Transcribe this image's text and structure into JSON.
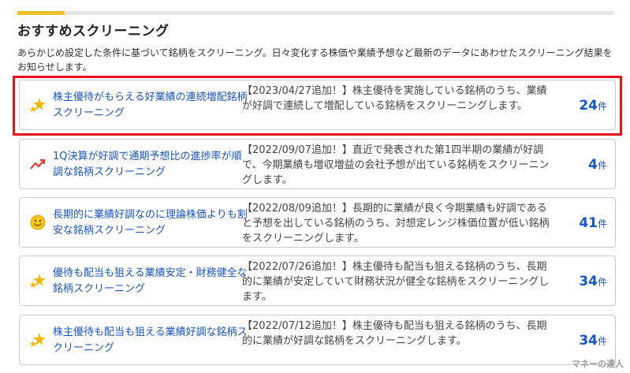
{
  "section": {
    "title": "おすすめスクリーニング",
    "intro": "あらかじめ設定した条件に基づいて銘柄をスクリーニング。日々変化する株価や業績予想など最新のデータにあわせたスクリーニング結果をお知らせします。"
  },
  "cards": [
    {
      "icon": "star-icon",
      "name": "株主優待がもらえる好業績の連続増配銘柄スクリーニング",
      "description": "【2023/04/27追加！】株主優待を実施している銘柄のうち、業績が好調で連続して増配している銘柄をスクリーニングします。",
      "count": "24",
      "unit": "件",
      "highlighted": true
    },
    {
      "icon": "trend-up-icon",
      "name": "1Q決算が好調で通期予想比の進捗率が順調な銘柄スクリーニング",
      "description": "【2022/09/07追加！】直近で発表された第1四半期の業績が好調で、今期業績も増収増益の会社予想が出ている銘柄をスクリーニングします。",
      "count": "4",
      "unit": "件"
    },
    {
      "icon": "smiley-icon",
      "name": "長期的に業績好調なのに理論株価よりも割安な銘柄スクリーニング",
      "description": "【2022/08/09追加！】長期的に業績が良く今期業績も好調であると予想を出している銘柄のうち、対想定レンジ株価位置が低い銘柄をスクリーニングします。",
      "count": "41",
      "unit": "件"
    },
    {
      "icon": "star-icon",
      "name": "優待も配当も狙える業績安定・財務健全な銘柄スクリーニング",
      "description": "【2022/07/26追加！】株主優待も配当も狙える銘柄のうち、長期的に業績が安定していて財務状況が健全な銘柄をスクリーニングします。",
      "count": "34",
      "unit": "件"
    },
    {
      "icon": "star-icon",
      "name": "株主優待も配当も狙える業績好調な銘柄スクリーニング",
      "description": "【2022/07/12追加！】株主優待も配当も狙える銘柄のうち、長期的に業績が好調な銘柄をスクリーニングします。",
      "count": "34",
      "unit": "件"
    }
  ],
  "watermark": "マネーの達人",
  "colors": {
    "accent": "#f2c02b",
    "link": "#1a55c4",
    "highlight": "#e8121b"
  }
}
